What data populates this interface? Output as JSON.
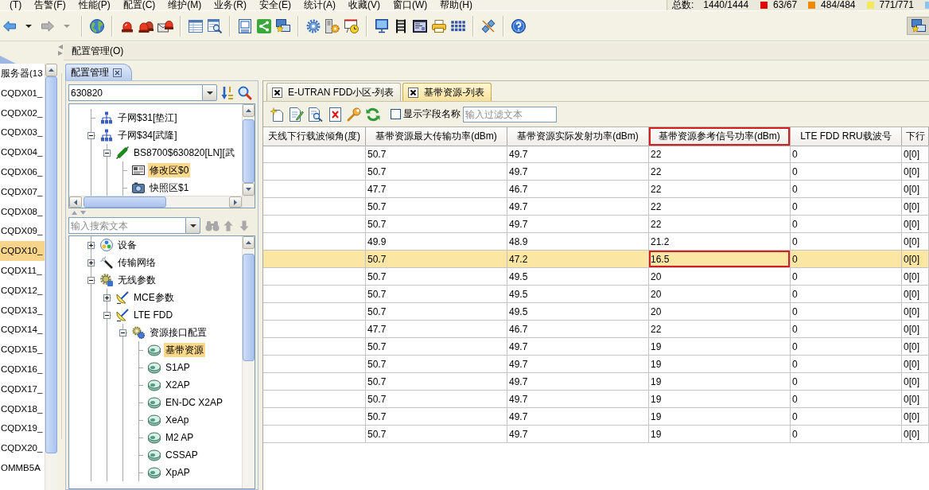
{
  "menu_bar": {
    "items": [
      "(T)",
      "告警(F)",
      "性能(P)",
      "配置(C)",
      "维护(M)",
      "业务(R)",
      "安全(E)",
      "统计(A)",
      "收藏(V)",
      "窗口(W)",
      "帮助(H)"
    ],
    "alarm_summary": {
      "label": "总数:",
      "total": "1440/1444",
      "levels": [
        {
          "color": "#e00000",
          "count": "63/67"
        },
        {
          "color": "#f08a00",
          "count": "484/484"
        },
        {
          "color": "#f2ea5a",
          "count": "771/771"
        },
        {
          "color": "#8cc6f0"
        }
      ]
    }
  },
  "view_header": {
    "title": "配置管理(O)"
  },
  "node_list": {
    "items": [
      {
        "label": "服务器(13",
        "selected": false
      },
      {
        "label": "CQDX01_",
        "selected": false
      },
      {
        "label": "CQDX02_",
        "selected": false
      },
      {
        "label": "CQDX03_",
        "selected": false
      },
      {
        "label": "CQDX04_",
        "selected": false
      },
      {
        "label": "CQDX06_",
        "selected": false
      },
      {
        "label": "CQDX07_",
        "selected": false
      },
      {
        "label": "CQDX08_",
        "selected": false
      },
      {
        "label": "CQDX09_",
        "selected": false
      },
      {
        "label": "CQDX10_",
        "selected": true
      },
      {
        "label": "CQDX11_",
        "selected": false
      },
      {
        "label": "CQDX12_",
        "selected": false
      },
      {
        "label": "CQDX13_",
        "selected": false
      },
      {
        "label": "CQDX14_",
        "selected": false
      },
      {
        "label": "CQDX15_",
        "selected": false
      },
      {
        "label": "CQDX16_",
        "selected": false
      },
      {
        "label": "CQDX17_",
        "selected": false
      },
      {
        "label": "CQDX18_",
        "selected": false
      },
      {
        "label": "CQDX19_",
        "selected": false
      },
      {
        "label": "CQDX20_",
        "selected": false
      },
      {
        "label": "OMMB5A",
        "selected": false
      }
    ]
  },
  "config_panel": {
    "tab": {
      "label": "配置管理"
    },
    "ne_search": {
      "value": "630820"
    },
    "ne_tree": {
      "items": [
        {
          "label": "子网$31[垫江]",
          "kind": "subnet",
          "selected": false
        },
        {
          "label": "子网$34[武隆]",
          "kind": "subnet",
          "selected": false,
          "expanded": true,
          "children": [
            {
              "label": "BS8700$630820[LN][武",
              "kind": "base_station",
              "selected": false,
              "expanded": true,
              "children": [
                {
                  "label": "修改区$0",
                  "kind": "modify_area",
                  "selected": true
                },
                {
                  "label": "快照区$1",
                  "kind": "snapshot",
                  "selected": false
                }
              ]
            }
          ]
        }
      ]
    },
    "search": {
      "placeholder": "输入搜索文本"
    },
    "resource_tree": {
      "items": [
        {
          "label": "设备",
          "kind": "equipment",
          "selected": false,
          "expanded": false
        },
        {
          "label": "传输网络",
          "kind": "transport",
          "selected": false,
          "expanded": false
        },
        {
          "label": "无线参数",
          "kind": "wireless",
          "selected": false,
          "expanded": true,
          "children": [
            {
              "label": "MCE参数",
              "kind": "satellite",
              "selected": false,
              "expanded": false
            },
            {
              "label": "LTE FDD",
              "kind": "satellite",
              "selected": false,
              "expanded": true,
              "children": [
                {
                  "label": "资源接口配置",
                  "kind": "gears",
                  "selected": false,
                  "expanded": true,
                  "children": [
                    {
                      "label": "基带资源",
                      "kind": "resource",
                      "selected": true
                    },
                    {
                      "label": "S1AP",
                      "kind": "resource",
                      "selected": false
                    },
                    {
                      "label": "X2AP",
                      "kind": "resource",
                      "selected": false
                    },
                    {
                      "label": "EN-DC X2AP",
                      "kind": "resource",
                      "selected": false
                    },
                    {
                      "label": "XeAp",
                      "kind": "resource",
                      "selected": false
                    },
                    {
                      "label": "M2 AP",
                      "kind": "resource",
                      "selected": false
                    },
                    {
                      "label": "CSSAP",
                      "kind": "resource",
                      "selected": false
                    },
                    {
                      "label": "XpAP",
                      "kind": "resource",
                      "selected": false
                    }
                  ]
                }
              ]
            }
          ]
        }
      ]
    }
  },
  "list_view": {
    "tabs": [
      {
        "label": "E-UTRAN FDD小区-列表",
        "selected": false
      },
      {
        "label": "基带资源-列表",
        "selected": true
      }
    ],
    "toolbar": {
      "show_field_names": {
        "label": "显示字段名称",
        "checked": false
      },
      "filter": {
        "placeholder": "输入过滤文本"
      }
    },
    "table": {
      "columns": [
        {
          "label": "天线下行载波倾角(度)",
          "outlined": false
        },
        {
          "label": "基带资源最大传输功率(dBm)",
          "outlined": false
        },
        {
          "label": "基带资源实际发射功率(dBm)",
          "outlined": false
        },
        {
          "label": "基带资源参考信号功率(dBm)",
          "outlined": true
        },
        {
          "label": "LTE FDD RRU载波号",
          "outlined": false
        },
        {
          "label": "下行",
          "outlined": false
        }
      ],
      "rows": [
        {
          "selected": false,
          "outlined": false,
          "cells": [
            null,
            "50.7",
            "49.7",
            "22",
            "0",
            "0[0]"
          ]
        },
        {
          "selected": false,
          "outlined": false,
          "cells": [
            null,
            "50.7",
            "49.7",
            "22",
            "0",
            "0[0]"
          ]
        },
        {
          "selected": false,
          "outlined": false,
          "cells": [
            null,
            "47.7",
            "46.7",
            "22",
            "0",
            "0[0]"
          ]
        },
        {
          "selected": false,
          "outlined": false,
          "cells": [
            null,
            "50.7",
            "49.7",
            "22",
            "0",
            "0[0]"
          ]
        },
        {
          "selected": false,
          "outlined": false,
          "cells": [
            null,
            "50.7",
            "49.7",
            "22",
            "0",
            "0[0]"
          ]
        },
        {
          "selected": false,
          "outlined": false,
          "cells": [
            null,
            "49.9",
            "48.9",
            "21.2",
            "0",
            "0[0]"
          ]
        },
        {
          "selected": true,
          "outlined": true,
          "cells": [
            null,
            "50.7",
            "47.2",
            "16.5",
            "0",
            "0[0]"
          ]
        },
        {
          "selected": false,
          "outlined": false,
          "cells": [
            null,
            "50.7",
            "49.5",
            "20",
            "0",
            "0[0]"
          ]
        },
        {
          "selected": false,
          "outlined": false,
          "cells": [
            null,
            "50.7",
            "49.5",
            "20",
            "0",
            "0[0]"
          ]
        },
        {
          "selected": false,
          "outlined": false,
          "cells": [
            null,
            "50.7",
            "49.5",
            "20",
            "0",
            "0[0]"
          ]
        },
        {
          "selected": false,
          "outlined": false,
          "cells": [
            null,
            "47.7",
            "46.7",
            "22",
            "0",
            "0[0]"
          ]
        },
        {
          "selected": false,
          "outlined": false,
          "cells": [
            null,
            "50.7",
            "49.7",
            "19",
            "0",
            "0[0]"
          ]
        },
        {
          "selected": false,
          "outlined": false,
          "cells": [
            null,
            "50.7",
            "49.7",
            "19",
            "0",
            "0[0]"
          ]
        },
        {
          "selected": false,
          "outlined": false,
          "cells": [
            null,
            "50.7",
            "49.7",
            "19",
            "0",
            "0[0]"
          ]
        },
        {
          "selected": false,
          "outlined": false,
          "cells": [
            null,
            "50.7",
            "49.7",
            "19",
            "0",
            "0[0]"
          ]
        },
        {
          "selected": false,
          "outlined": false,
          "cells": [
            null,
            "50.7",
            "49.7",
            "19",
            "0",
            "0[0]"
          ]
        },
        {
          "selected": false,
          "outlined": false,
          "cells": [
            null,
            "50.7",
            "49.7",
            "19",
            "0",
            "0[0]"
          ]
        }
      ]
    }
  }
}
